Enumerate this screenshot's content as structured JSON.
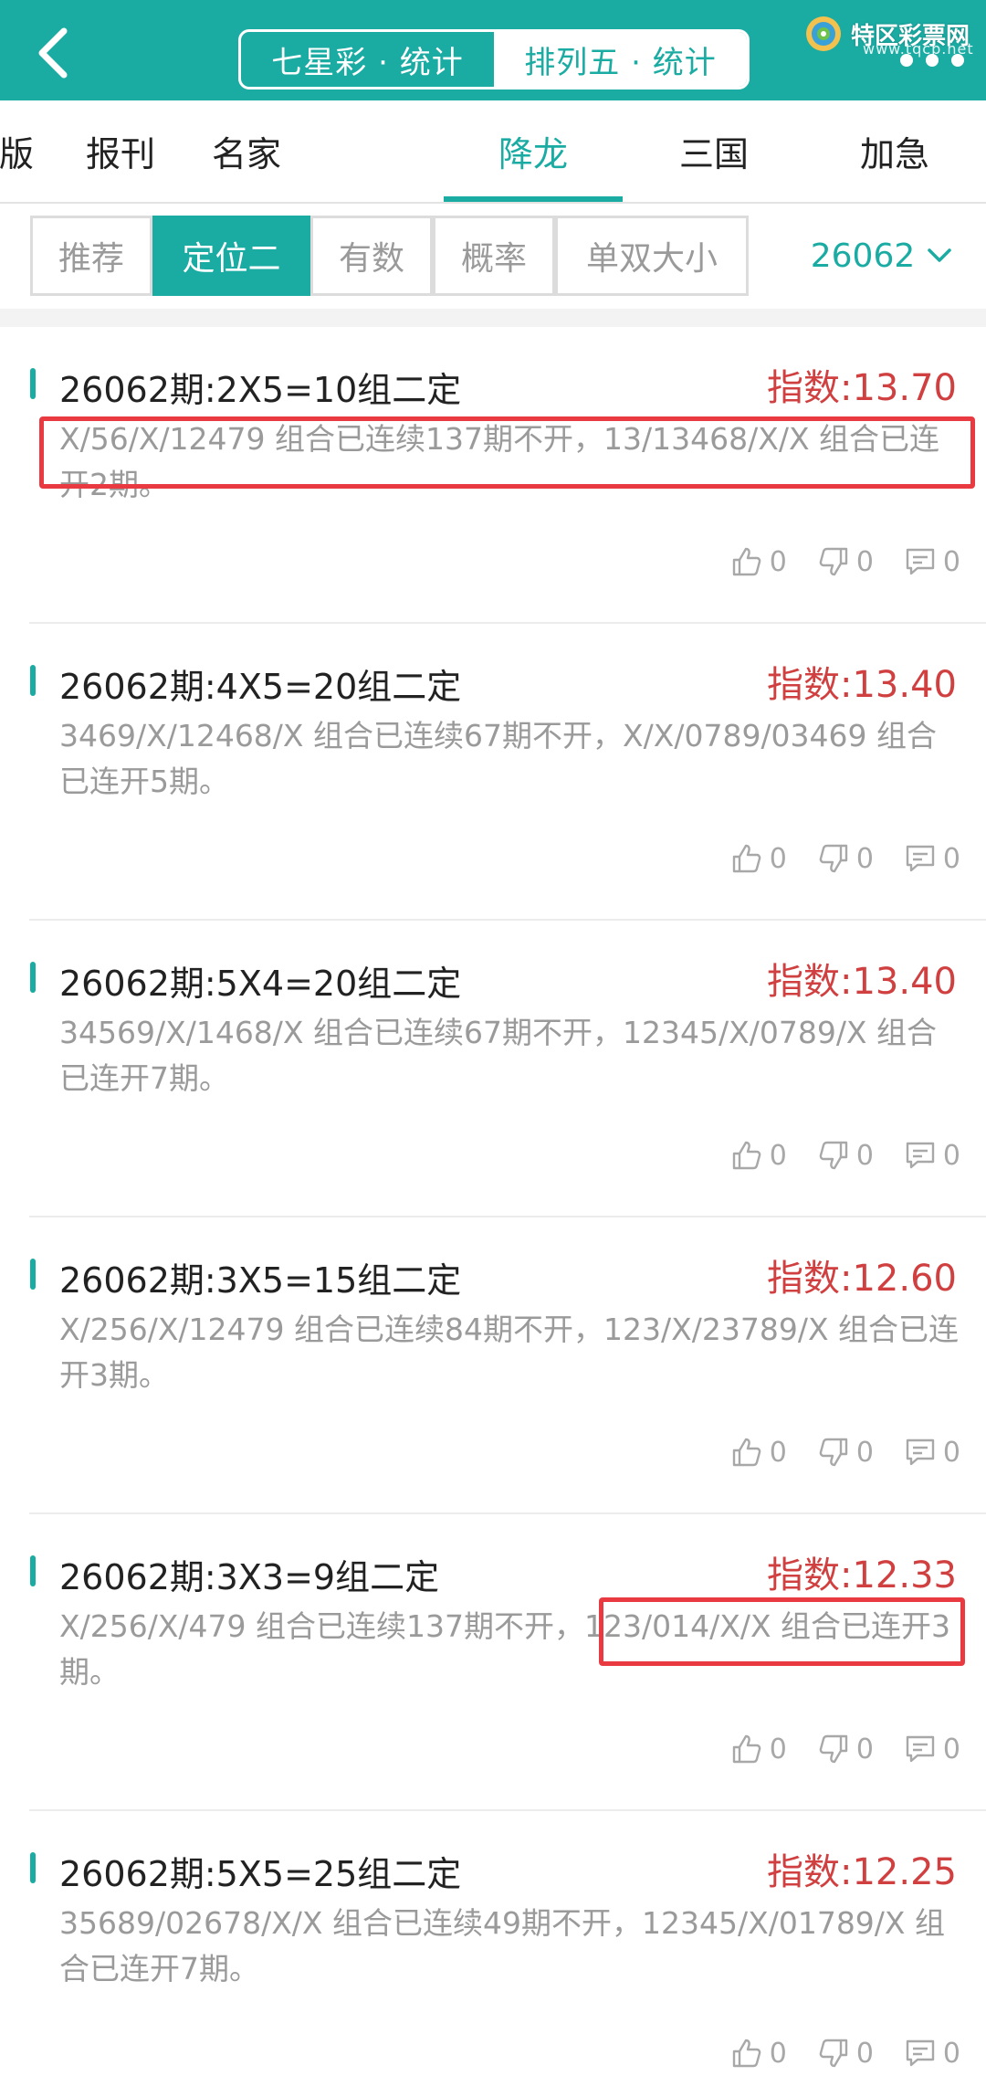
{
  "header": {
    "back_icon": "chevron-left-icon",
    "segments": [
      {
        "label": "七星彩 · 统计",
        "active": false
      },
      {
        "label": "排列五 · 统计",
        "active": true
      }
    ],
    "logo_text": "特区彩票网",
    "logo_sub": "www.tqcp.net",
    "accent_color": "#1aaba3"
  },
  "tabs": [
    {
      "label": "版",
      "active": false
    },
    {
      "label": "报刊",
      "active": false
    },
    {
      "label": "名家",
      "active": false
    },
    {
      "label": "降龙",
      "active": true
    },
    {
      "label": "三国",
      "active": false
    },
    {
      "label": "加急",
      "active": false
    }
  ],
  "filters": {
    "chips": [
      {
        "label": "推荐",
        "active": false
      },
      {
        "label": "定位二",
        "active": true
      },
      {
        "label": "有数",
        "active": false
      },
      {
        "label": "概率",
        "active": false
      },
      {
        "label": "单双大小",
        "active": false
      }
    ],
    "issue": "26062"
  },
  "items": [
    {
      "title": "26062期:2X5=10组二定",
      "index": "指数:13.70",
      "desc": "X/56/X/12479 组合已连续137期不开，13/13468/X/X 组合已连开2期。",
      "likes": "0",
      "dislikes": "0",
      "comments": "0"
    },
    {
      "title": "26062期:4X5=20组二定",
      "index": "指数:13.40",
      "desc": "3469/X/12468/X 组合已连续67期不开，X/X/0789/03469 组合已连开5期。",
      "likes": "0",
      "dislikes": "0",
      "comments": "0"
    },
    {
      "title": "26062期:5X4=20组二定",
      "index": "指数:13.40",
      "desc": "34569/X/1468/X 组合已连续67期不开，12345/X/0789/X 组合已连开7期。",
      "likes": "0",
      "dislikes": "0",
      "comments": "0"
    },
    {
      "title": "26062期:3X5=15组二定",
      "index": "指数:12.60",
      "desc": "X/256/X/12479 组合已连续84期不开，123/X/23789/X 组合已连开3期。",
      "likes": "0",
      "dislikes": "0",
      "comments": "0"
    },
    {
      "title": "26062期:3X3=9组二定",
      "index": "指数:12.33",
      "desc": "X/256/X/479 组合已连续137期不开，123/014/X/X 组合已连开3期。",
      "likes": "0",
      "dislikes": "0",
      "comments": "0"
    },
    {
      "title": "26062期:5X5=25组二定",
      "index": "指数:12.25",
      "desc": "35689/02678/X/X 组合已连续49期不开，12345/X/01789/X 组合已连开7期。",
      "likes": "0",
      "dislikes": "0",
      "comments": "0"
    }
  ],
  "highlight_color": "#e83a40"
}
